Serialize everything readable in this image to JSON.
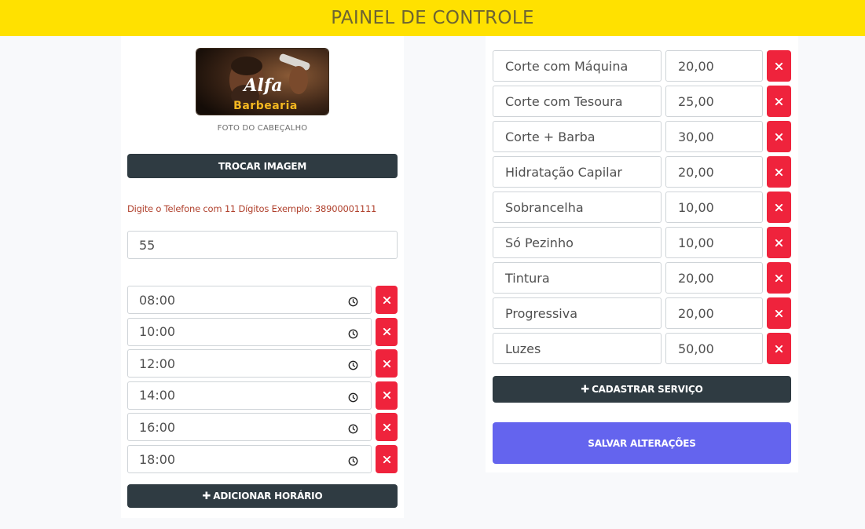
{
  "header": {
    "title": "PAINEL DE CONTROLE",
    "bg_color": "#ffe100"
  },
  "left": {
    "logo": {
      "line1": "Alfa",
      "line2": "Barbearia"
    },
    "logo_caption": "FOTO DO CABEÇALHO",
    "change_image_label": "TROCAR IMAGEM",
    "phone_hint": "Digite o Telefone com 11 Dígitos Exemplo: 38900001111",
    "phone_value": "55",
    "times": [
      {
        "value": "08:00"
      },
      {
        "value": "10:00"
      },
      {
        "value": "12:00"
      },
      {
        "value": "14:00"
      },
      {
        "value": "16:00"
      },
      {
        "value": "18:00"
      }
    ],
    "add_time_label": "ADICIONAR HORÁRIO",
    "add_icon": "plus-icon"
  },
  "right": {
    "services": [
      {
        "name": "Corte com Máquina",
        "price": "20,00"
      },
      {
        "name": "Corte com Tesoura",
        "price": "25,00"
      },
      {
        "name": "Corte + Barba",
        "price": "30,00"
      },
      {
        "name": "Hidratação Capilar",
        "price": "20,00"
      },
      {
        "name": "Sobrancelha",
        "price": "10,00"
      },
      {
        "name": "Só Pezinho",
        "price": "10,00"
      },
      {
        "name": "Tintura",
        "price": "20,00"
      },
      {
        "name": "Progressiva",
        "price": "20,00"
      },
      {
        "name": "Luzes",
        "price": "50,00"
      }
    ],
    "add_service_label": "CADASTRAR SERVIÇO",
    "save_label": "SALVAR ALTERAÇÕES"
  },
  "colors": {
    "delete": "#ef233c",
    "dark_button": "#2f3b42",
    "save_button": "#6464ee",
    "hint_text": "#b0412d"
  }
}
